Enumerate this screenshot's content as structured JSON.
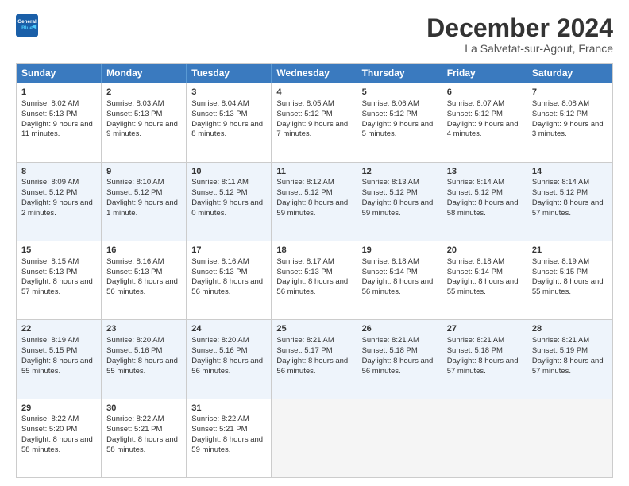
{
  "logo": {
    "line1": "General",
    "line2": "Blue"
  },
  "title": "December 2024",
  "subtitle": "La Salvetat-sur-Agout, France",
  "days_of_week": [
    "Sunday",
    "Monday",
    "Tuesday",
    "Wednesday",
    "Thursday",
    "Friday",
    "Saturday"
  ],
  "weeks": [
    [
      {
        "day": 1,
        "sunrise": "8:02 AM",
        "sunset": "5:13 PM",
        "daylight": "9 hours and 11 minutes."
      },
      {
        "day": 2,
        "sunrise": "8:03 AM",
        "sunset": "5:13 PM",
        "daylight": "9 hours and 9 minutes."
      },
      {
        "day": 3,
        "sunrise": "8:04 AM",
        "sunset": "5:13 PM",
        "daylight": "9 hours and 8 minutes."
      },
      {
        "day": 4,
        "sunrise": "8:05 AM",
        "sunset": "5:12 PM",
        "daylight": "9 hours and 7 minutes."
      },
      {
        "day": 5,
        "sunrise": "8:06 AM",
        "sunset": "5:12 PM",
        "daylight": "9 hours and 5 minutes."
      },
      {
        "day": 6,
        "sunrise": "8:07 AM",
        "sunset": "5:12 PM",
        "daylight": "9 hours and 4 minutes."
      },
      {
        "day": 7,
        "sunrise": "8:08 AM",
        "sunset": "5:12 PM",
        "daylight": "9 hours and 3 minutes."
      }
    ],
    [
      {
        "day": 8,
        "sunrise": "8:09 AM",
        "sunset": "5:12 PM",
        "daylight": "9 hours and 2 minutes."
      },
      {
        "day": 9,
        "sunrise": "8:10 AM",
        "sunset": "5:12 PM",
        "daylight": "9 hours and 1 minute."
      },
      {
        "day": 10,
        "sunrise": "8:11 AM",
        "sunset": "5:12 PM",
        "daylight": "9 hours and 0 minutes."
      },
      {
        "day": 11,
        "sunrise": "8:12 AM",
        "sunset": "5:12 PM",
        "daylight": "8 hours and 59 minutes."
      },
      {
        "day": 12,
        "sunrise": "8:13 AM",
        "sunset": "5:12 PM",
        "daylight": "8 hours and 59 minutes."
      },
      {
        "day": 13,
        "sunrise": "8:14 AM",
        "sunset": "5:12 PM",
        "daylight": "8 hours and 58 minutes."
      },
      {
        "day": 14,
        "sunrise": "8:14 AM",
        "sunset": "5:12 PM",
        "daylight": "8 hours and 57 minutes."
      }
    ],
    [
      {
        "day": 15,
        "sunrise": "8:15 AM",
        "sunset": "5:13 PM",
        "daylight": "8 hours and 57 minutes."
      },
      {
        "day": 16,
        "sunrise": "8:16 AM",
        "sunset": "5:13 PM",
        "daylight": "8 hours and 56 minutes."
      },
      {
        "day": 17,
        "sunrise": "8:16 AM",
        "sunset": "5:13 PM",
        "daylight": "8 hours and 56 minutes."
      },
      {
        "day": 18,
        "sunrise": "8:17 AM",
        "sunset": "5:13 PM",
        "daylight": "8 hours and 56 minutes."
      },
      {
        "day": 19,
        "sunrise": "8:18 AM",
        "sunset": "5:14 PM",
        "daylight": "8 hours and 56 minutes."
      },
      {
        "day": 20,
        "sunrise": "8:18 AM",
        "sunset": "5:14 PM",
        "daylight": "8 hours and 55 minutes."
      },
      {
        "day": 21,
        "sunrise": "8:19 AM",
        "sunset": "5:15 PM",
        "daylight": "8 hours and 55 minutes."
      }
    ],
    [
      {
        "day": 22,
        "sunrise": "8:19 AM",
        "sunset": "5:15 PM",
        "daylight": "8 hours and 55 minutes."
      },
      {
        "day": 23,
        "sunrise": "8:20 AM",
        "sunset": "5:16 PM",
        "daylight": "8 hours and 55 minutes."
      },
      {
        "day": 24,
        "sunrise": "8:20 AM",
        "sunset": "5:16 PM",
        "daylight": "8 hours and 56 minutes."
      },
      {
        "day": 25,
        "sunrise": "8:21 AM",
        "sunset": "5:17 PM",
        "daylight": "8 hours and 56 minutes."
      },
      {
        "day": 26,
        "sunrise": "8:21 AM",
        "sunset": "5:18 PM",
        "daylight": "8 hours and 56 minutes."
      },
      {
        "day": 27,
        "sunrise": "8:21 AM",
        "sunset": "5:18 PM",
        "daylight": "8 hours and 57 minutes."
      },
      {
        "day": 28,
        "sunrise": "8:21 AM",
        "sunset": "5:19 PM",
        "daylight": "8 hours and 57 minutes."
      }
    ],
    [
      {
        "day": 29,
        "sunrise": "8:22 AM",
        "sunset": "5:20 PM",
        "daylight": "8 hours and 58 minutes."
      },
      {
        "day": 30,
        "sunrise": "8:22 AM",
        "sunset": "5:21 PM",
        "daylight": "8 hours and 58 minutes."
      },
      {
        "day": 31,
        "sunrise": "8:22 AM",
        "sunset": "5:21 PM",
        "daylight": "8 hours and 59 minutes."
      },
      null,
      null,
      null,
      null
    ]
  ],
  "labels": {
    "sunrise": "Sunrise:",
    "sunset": "Sunset:",
    "daylight": "Daylight:"
  }
}
